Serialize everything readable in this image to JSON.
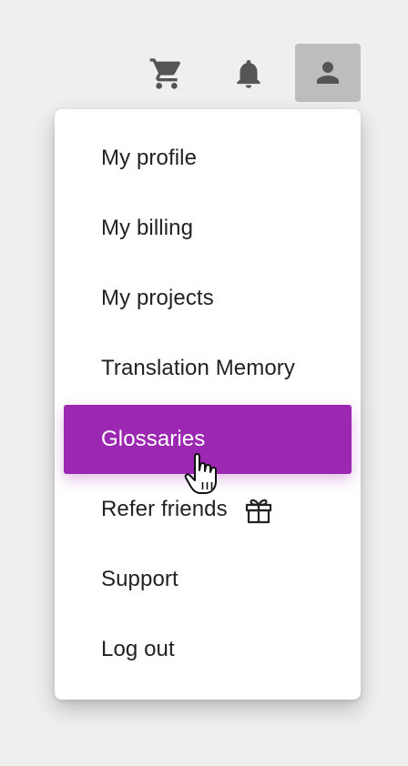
{
  "topbar": {
    "icons": [
      "cart-icon",
      "bell-icon",
      "account-icon"
    ]
  },
  "colors": {
    "background": "#efefef",
    "icon": "#555555",
    "account_button_bg": "#bdbdbd",
    "menu_bg": "#ffffff",
    "active_bg": "#9c27b0",
    "active_text": "#ffffff",
    "text": "#222222"
  },
  "menu": {
    "items": [
      {
        "label": "My profile"
      },
      {
        "label": "My billing"
      },
      {
        "label": "My projects"
      },
      {
        "label": "Translation Memory"
      },
      {
        "label": "Glossaries",
        "active": true
      },
      {
        "label": "Refer friends",
        "icon": "gift-icon"
      },
      {
        "label": "Support"
      },
      {
        "label": "Log out"
      }
    ]
  }
}
